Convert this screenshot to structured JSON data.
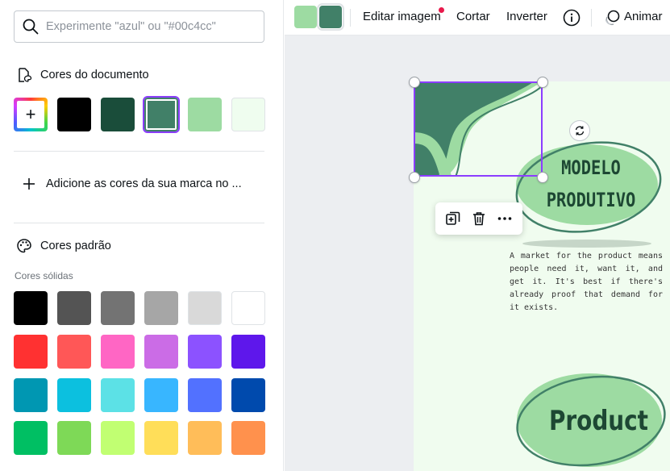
{
  "search": {
    "placeholder": "Experimente \"azul\" ou \"#00c4cc\""
  },
  "doc_colors": {
    "title": "Cores do documento",
    "swatches": [
      "#000000",
      "#1a4d3a",
      "#418068",
      "#9ddba2",
      "#effdef"
    ],
    "selected_index": 2
  },
  "brand": {
    "label": "Adicione as cores da sua marca no ..."
  },
  "default_colors": {
    "title": "Cores padrão",
    "subtitle": "Cores sólidas",
    "rows": [
      [
        "#000000",
        "#545454",
        "#737373",
        "#a6a6a6",
        "#d9d9d9",
        "#ffffff"
      ],
      [
        "#ff3131",
        "#ff5757",
        "#ff66c4",
        "#cb6ce6",
        "#8c52ff",
        "#5e17eb"
      ],
      [
        "#0097b2",
        "#0cc0df",
        "#5ce1e6",
        "#38b6ff",
        "#5271ff",
        "#004aad"
      ],
      [
        "#00bf63",
        "#7ed957",
        "#c1ff72",
        "#ffde59",
        "#ffbd59",
        "#ff914d"
      ]
    ]
  },
  "toolbar": {
    "swatches": [
      "#9ddba2",
      "#418068"
    ],
    "edit_image": "Editar imagem",
    "crop": "Cortar",
    "flip": "Inverter",
    "animate": "Animar"
  },
  "canvas": {
    "title_line1": "MODELO",
    "title_line2": "PRODUTIVO",
    "body": "A market for the product means people need it, want it, and get it. It's best if there's already proof that demand for it exists.",
    "product": "Product"
  }
}
